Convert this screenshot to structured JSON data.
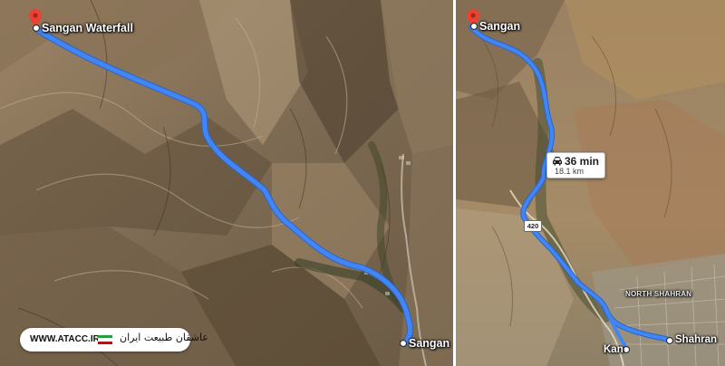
{
  "left_map": {
    "origin_label": "Sangan Waterfall",
    "destination_label": "Sangan"
  },
  "right_map": {
    "origin_label": "Sangan",
    "route_time": "36 min",
    "route_distance": "18.1 km",
    "highway_label": "420",
    "district_label": "NORTH SHAHRAN",
    "place_kan": "Kan",
    "place_shahran": "Shahran"
  },
  "watermark": {
    "url": "WWW.ATACC.IR",
    "logo_text": "عاشقان طبیعت ایران"
  },
  "colors": {
    "route": "#4285f4",
    "pin": "#ea4335",
    "terrain_light": "#a99272",
    "terrain_dark": "#4a3b2b"
  },
  "icons": {
    "pin": "map-pin-icon",
    "car": "car-icon",
    "endpoint": "route-endpoint-icon"
  }
}
